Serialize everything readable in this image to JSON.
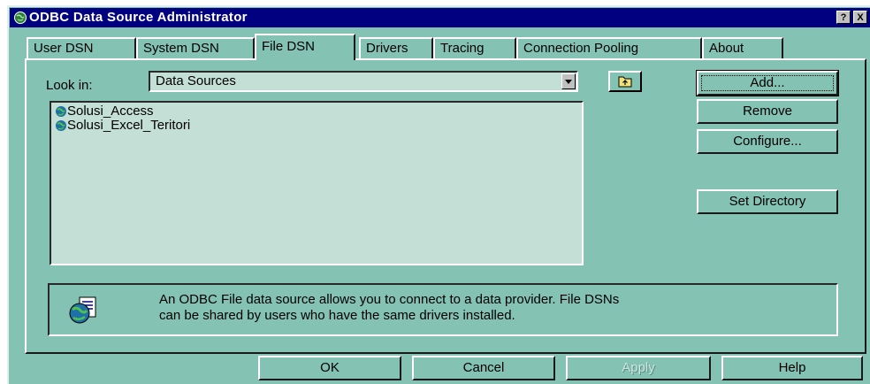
{
  "window": {
    "title": "ODBC Data Source Administrator",
    "help_btn": "?",
    "close_btn": "X"
  },
  "tabs": [
    {
      "label": "User DSN"
    },
    {
      "label": "System DSN"
    },
    {
      "label": "File DSN",
      "active": true
    },
    {
      "label": "Drivers"
    },
    {
      "label": "Tracing"
    },
    {
      "label": "Connection Pooling"
    },
    {
      "label": "About"
    }
  ],
  "lookin": {
    "label": "Look in:",
    "value": "Data Sources"
  },
  "files": [
    {
      "name": "Solusi_Access",
      "icon": "globe-file-dsn-icon"
    },
    {
      "name": "Solusi_Excel_Teritori",
      "icon": "globe-file-dsn-icon"
    }
  ],
  "side_buttons": {
    "add": "Add...",
    "remove": "Remove",
    "configure": "Configure...",
    "set_directory": "Set Directory"
  },
  "info": {
    "line1": "An ODBC File data source allows you to connect to a data provider.  File DSNs",
    "line2": "can be shared by users who have the same drivers installed."
  },
  "footer": {
    "ok": "OK",
    "cancel": "Cancel",
    "apply": "Apply",
    "help": "Help"
  },
  "colors": {
    "face": "#84c2b4",
    "list_bg": "#c3dfd6",
    "title_bar": "#000080"
  }
}
